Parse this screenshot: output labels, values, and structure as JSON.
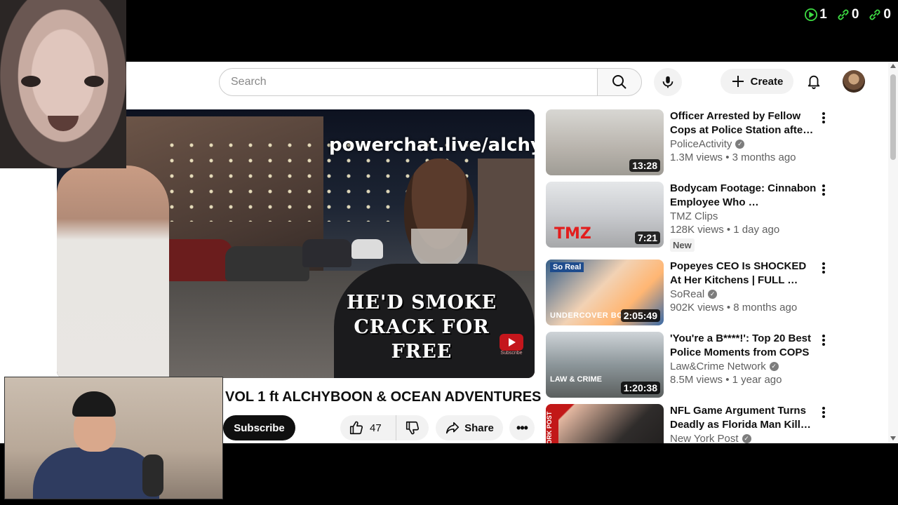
{
  "stream_counters": [
    {
      "icon": "play-icon",
      "value": "1",
      "color": "#3ddc43"
    },
    {
      "icon": "link-icon",
      "value": "0",
      "color": "#3ddc43"
    },
    {
      "icon": "link-icon",
      "value": "0",
      "color": "#3ddc43"
    }
  ],
  "masthead": {
    "search_placeholder": "Search",
    "create_label": "Create"
  },
  "video": {
    "overlay_url": "powerchat.live/alchy",
    "overlay_caption": "HE'D SMOKE CRACK FOR FREE",
    "badge_label": "Subscribe",
    "title": "VOL 1 ft ALCHYBOON & OCEAN ADVENTURES",
    "subscribe_label": "Subscribe",
    "likes": "47",
    "share_label": "Share"
  },
  "recommendations": [
    {
      "title": "Officer Arrested by Fellow Cops at Police Station afte…",
      "channel": "PoliceActivity",
      "verified": true,
      "meta": "1.3M views • 3 months ago",
      "duration": "13:28",
      "badge": ""
    },
    {
      "title": "Bodycam Footage: Cinnabon Employee Who …",
      "channel": "TMZ Clips",
      "verified": false,
      "meta": "128K views • 1 day ago",
      "duration": "7:21",
      "badge": "New"
    },
    {
      "title": "Popeyes CEO Is SHOCKED At Her Kitchens | FULL …",
      "channel": "SoReal",
      "verified": true,
      "meta": "902K views • 8 months ago",
      "duration": "2:05:49",
      "badge": ""
    },
    {
      "title": "'You're a B****!': Top 20 Best Police Moments from COPS",
      "channel": "Law&Crime Network",
      "verified": true,
      "meta": "8.5M views • 1 year ago",
      "duration": "1:20:38",
      "badge": ""
    },
    {
      "title": "NFL Game Argument Turns Deadly as Florida Man Kill…",
      "channel": "New York Post",
      "verified": true,
      "meta": "",
      "duration": "",
      "badge": ""
    }
  ],
  "thumb_labels": {
    "tmz": "TMZ",
    "soreal": "So Real",
    "undercover": "UNDERCOVER BOS",
    "lawcrime": "LAW & CRIME",
    "nypost": "NEW YORK POST"
  }
}
